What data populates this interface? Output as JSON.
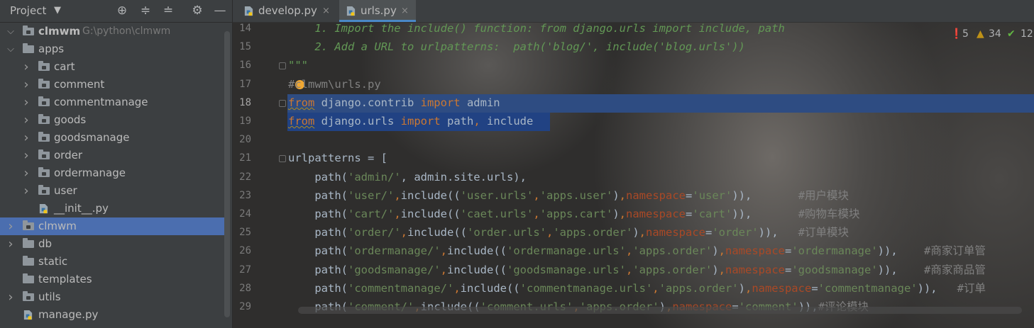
{
  "project_panel": {
    "title": "Project",
    "toolbar_icons": [
      "locate-icon",
      "expand-all-icon",
      "collapse-all-icon",
      "gear-icon",
      "minimize-icon"
    ],
    "tree": [
      {
        "label": "clmwm",
        "path": "G:\\python\\clmwm",
        "type": "root-folder",
        "depth": 0,
        "expanded": true
      },
      {
        "label": "apps",
        "type": "folder",
        "depth": 0,
        "expanded": true
      },
      {
        "label": "cart",
        "type": "module",
        "depth": 1,
        "expanded": false
      },
      {
        "label": "comment",
        "type": "module",
        "depth": 1,
        "expanded": false
      },
      {
        "label": "commentmanage",
        "type": "module",
        "depth": 1,
        "expanded": false
      },
      {
        "label": "goods",
        "type": "module",
        "depth": 1,
        "expanded": false
      },
      {
        "label": "goodsmanage",
        "type": "module",
        "depth": 1,
        "expanded": false
      },
      {
        "label": "order",
        "type": "module",
        "depth": 1,
        "expanded": false
      },
      {
        "label": "ordermanage",
        "type": "module",
        "depth": 1,
        "expanded": false
      },
      {
        "label": "user",
        "type": "module",
        "depth": 1,
        "expanded": false
      },
      {
        "label": "__init__.py",
        "type": "python-file",
        "depth": 1
      },
      {
        "label": "clmwm",
        "type": "module",
        "depth": 0,
        "expanded": false,
        "selected": true
      },
      {
        "label": "db",
        "type": "folder",
        "depth": 0,
        "expanded": false
      },
      {
        "label": "static",
        "type": "folder",
        "depth": 0
      },
      {
        "label": "templates",
        "type": "folder",
        "depth": 0
      },
      {
        "label": "utils",
        "type": "module",
        "depth": 0,
        "expanded": false
      },
      {
        "label": "manage.py",
        "type": "python-file",
        "depth": 0
      }
    ]
  },
  "tabs": [
    {
      "label": "develop.py",
      "active": false,
      "close": "×"
    },
    {
      "label": "urls.py",
      "active": true,
      "close": "×"
    }
  ],
  "inspection": {
    "errors": "5",
    "warnings": "34",
    "ok": "12"
  },
  "editor": {
    "line_numbers": [
      "14",
      "15",
      "16",
      "17",
      "18",
      "19",
      "20",
      "21",
      "22",
      "23",
      "24",
      "25",
      "26",
      "27",
      "28",
      "29"
    ],
    "current_line": "18",
    "highlighted_lines": [
      "18",
      "19"
    ],
    "lines": {
      "l14": "    1. Import the include() function: from django.urls import include, path",
      "l15": "    2. Add a URL to urlpatterns:  path('blog/', include('blog.urls'))",
      "l16": "\"\"\"",
      "l17": "#clmwm\\urls.py",
      "l18": [
        "from",
        " django.contrib ",
        "import",
        " admin"
      ],
      "l19": [
        "from",
        " django.urls ",
        "import",
        " path",
        ",",
        " include"
      ],
      "l21": "urlpatterns = [",
      "l22": [
        "    path(",
        "'admin/'",
        ", admin.site.urls),"
      ],
      "l23": [
        "    path(",
        "'user/'",
        ",",
        "include((",
        "'user.urls'",
        ",",
        "'apps.user'",
        ")",
        ",",
        "namespace",
        "=",
        "'user'",
        ")),",
        "       ",
        "#用户模块"
      ],
      "l24": [
        "    path(",
        "'cart/'",
        ",",
        "include((",
        "'caet.urls'",
        ",",
        "'apps.cart'",
        ")",
        ",",
        "namespace",
        "=",
        "'cart'",
        ")),",
        "       ",
        "#购物车模块"
      ],
      "l25": [
        "    path(",
        "'order/'",
        ",",
        "include((",
        "'order.urls'",
        ",",
        "'apps.order'",
        ")",
        ",",
        "namespace",
        "=",
        "'order'",
        ")),",
        "   ",
        "#订单模块"
      ],
      "l26": [
        "    path(",
        "'ordermanage/'",
        ",",
        "include((",
        "'ordermanage.urls'",
        ",",
        "'apps.order'",
        ")",
        ",",
        "namespace",
        "=",
        "'ordermanage'",
        ")),",
        "    ",
        "#商家订单管"
      ],
      "l27": [
        "    path(",
        "'goodsmanage/'",
        ",",
        "include((",
        "'goodsmanage.urls'",
        ",",
        "'apps.order'",
        ")",
        ",",
        "namespace",
        "=",
        "'goodsmanage'",
        ")),",
        "    ",
        "#商家商品管"
      ],
      "l28": [
        "    path(",
        "'commentmanage/'",
        ",",
        "include((",
        "'commentmanage.urls'",
        ",",
        "'apps.order'",
        ")",
        ",",
        "namespace",
        "=",
        "'commentmanage'",
        ")),",
        "   ",
        "#订单"
      ],
      "l29": [
        "    path(",
        "'comment/'",
        ",",
        "include((",
        "'comment.urls'",
        ",",
        "'apps.order'",
        ")",
        ",",
        "namespace",
        "=",
        "'comment'",
        ")),",
        "",
        "#评论模块"
      ]
    }
  }
}
